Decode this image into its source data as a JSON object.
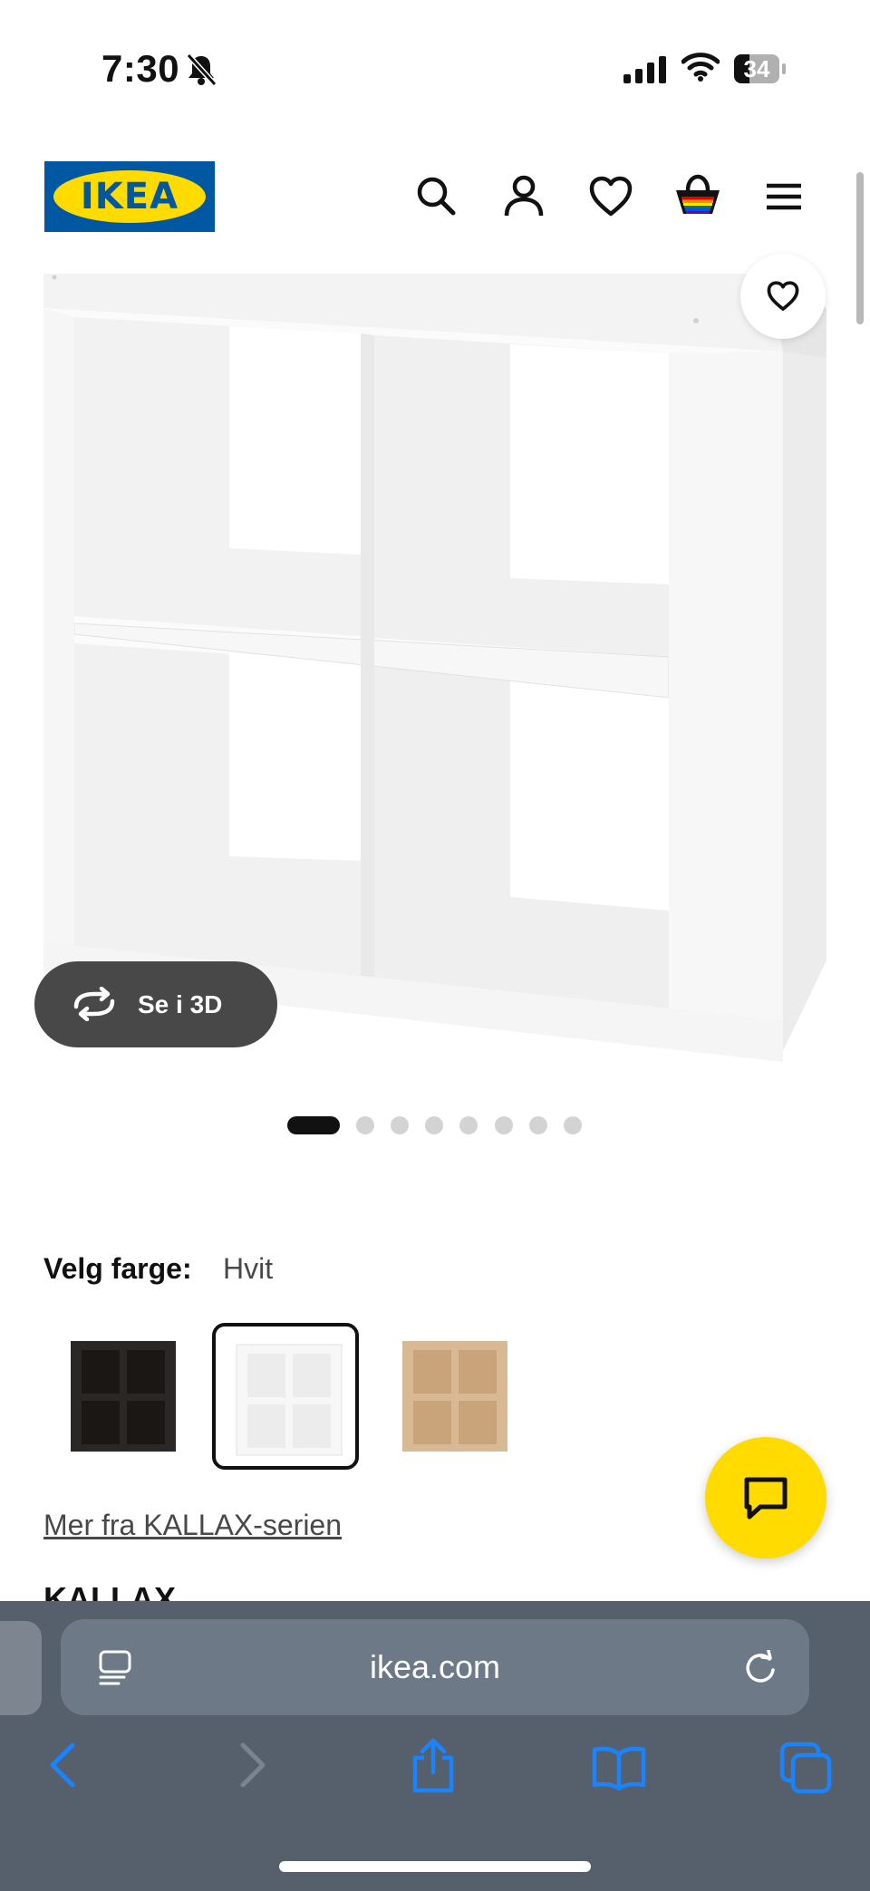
{
  "status_bar": {
    "time": "7:30",
    "battery": "34"
  },
  "header": {
    "logo_text": "IKEA"
  },
  "product_image": {
    "see_3d_label": "Se i 3D",
    "slide_count": 8,
    "active_slide": 1
  },
  "color_picker": {
    "label": "Velg farge:",
    "selected_value": "Hvit",
    "swatches": [
      {
        "color": "#2b2724",
        "selected": false
      },
      {
        "color": "#ffffff",
        "selected": true
      },
      {
        "color": "#d9b994",
        "selected": false
      }
    ]
  },
  "series_link": "Mer fra KALLAX-serien",
  "product": {
    "name": "KALLAX"
  },
  "browser": {
    "url": "ikea.com"
  },
  "colors": {
    "brand_blue": "#0058a3",
    "brand_yellow": "#ffdb00",
    "safari_blue": "#1a84ff"
  }
}
